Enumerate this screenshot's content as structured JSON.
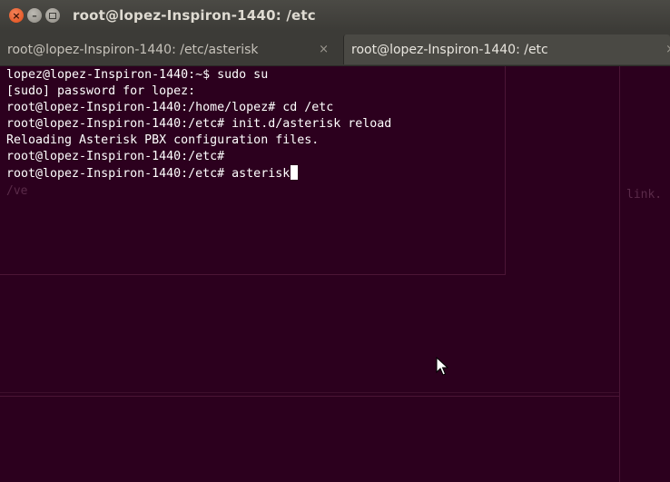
{
  "window": {
    "title": "root@lopez-Inspiron-1440: /etc",
    "close_glyph": "×",
    "min_glyph": "–"
  },
  "tabs": [
    {
      "label": "root@lopez-Inspiron-1440: /etc/asterisk",
      "close_glyph": "×",
      "active": false
    },
    {
      "label": "root@lopez-Inspiron-1440: /etc",
      "close_glyph": "×",
      "active": true
    }
  ],
  "terminal": {
    "lines": [
      "lopez@lopez-Inspiron-1440:~$ sudo su",
      "[sudo] password for lopez:",
      "root@lopez-Inspiron-1440:/home/lopez# cd /etc",
      "root@lopez-Inspiron-1440:/etc# init.d/asterisk reload",
      "Reloading Asterisk PBX configuration files.",
      "root@lopez-Inspiron-1440:/etc#",
      "root@lopez-Inspiron-1440:/etc# asterisk"
    ],
    "background_fragments": {
      "left": "/ve",
      "right": "link."
    }
  },
  "colors": {
    "terminal_bg": "#2c001e",
    "titlebar_bg": "#3c3b37",
    "close_button": "#df4b16",
    "text": "#ffffff"
  },
  "icons": [
    "close-icon",
    "minimize-icon",
    "maximize-icon",
    "tab-close-icon",
    "mouse-pointer-icon",
    "text-cursor"
  ]
}
